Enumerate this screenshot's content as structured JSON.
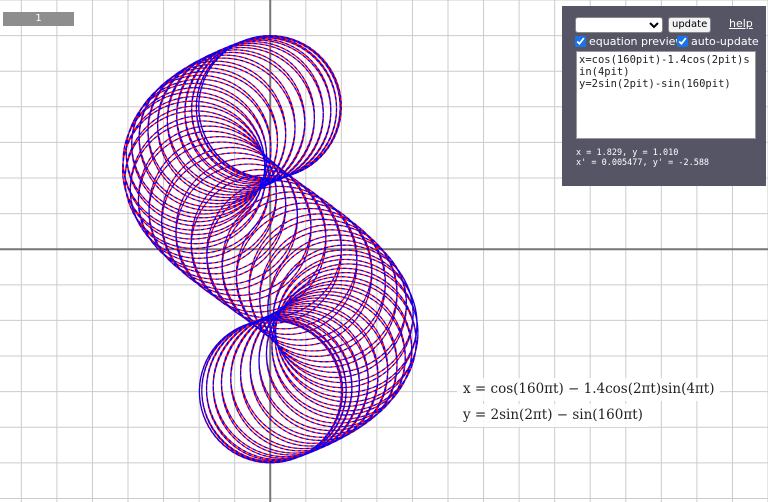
{
  "slider": {
    "value": "1"
  },
  "panel": {
    "preset_selected": "",
    "update_label": "update",
    "help_label": "help",
    "equation_preview_label": "equation preview",
    "equation_preview_checked": true,
    "auto_update_label": "auto-update",
    "auto_update_checked": true,
    "equations_text": "x=cos(160pit)-1.4cos(2pit)sin(4pit)\ny=2sin(2pit)-sin(160pit)",
    "point_readout": "x = 1.829, y = 1.010",
    "derivative_readout": "x' = 0.005477, y' = -2.588"
  },
  "preview": {
    "x_equation": "x = cos(160πt) − 1.4cos(2πt)sin(4πt)",
    "y_equation": "y = 2sin(2πt) − sin(160πt)"
  },
  "curve": {
    "x_expr": "cos(160*pi*t) - 1.4*cos(2*pi*t)*sin(4*pi*t)",
    "y_expr": "2*sin(2*pi*t) - sin(160*pi*t)",
    "t_range": [
      0,
      1
    ],
    "colors": [
      "#ff0000",
      "#0000ff"
    ]
  },
  "axes": {
    "x_range": [
      -3.8,
      7.0
    ],
    "y_range": [
      -3.55,
      3.5
    ],
    "grid_step": 0.5,
    "grid": true
  },
  "colors": {
    "grid": "#cccccc",
    "axis": "#777777",
    "panel_bg": "#555566"
  }
}
